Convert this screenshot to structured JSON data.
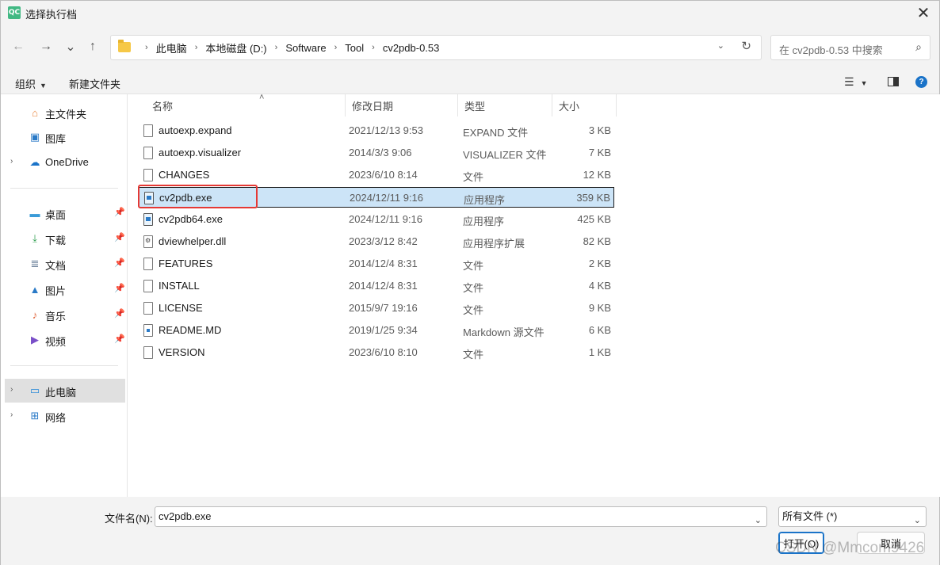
{
  "window": {
    "app_icon_text": "QC",
    "title": "选择执行档",
    "close_glyph": "✕"
  },
  "nav": {
    "back_glyph": "←",
    "forward_glyph": "→",
    "recent_glyph": "⌄",
    "up_glyph": "↑",
    "breadcrumbs": [
      "此电脑",
      "本地磁盘 (D:)",
      "Software",
      "Tool",
      "cv2pdb-0.53"
    ],
    "sep_glyph": "›",
    "dropdown_glyph": "⌄",
    "refresh_glyph": "↻",
    "search_placeholder": "在 cv2pdb-0.53 中搜索",
    "search_glyph": "⌕"
  },
  "commands": {
    "organize": "组织",
    "organize_arrow": "▼",
    "new_folder": "新建文件夹",
    "view_glyph": "☰",
    "view_arrow": "▼",
    "help_glyph": "?"
  },
  "sidebar": {
    "quick": [
      {
        "label": "主文件夹",
        "icon": "home-icon",
        "glyph": "⌂",
        "color": "#e8833a"
      },
      {
        "label": "图库",
        "icon": "gallery-icon",
        "glyph": "▣",
        "color": "#2a7ac7"
      },
      {
        "label": "OneDrive",
        "icon": "cloud-icon",
        "glyph": "☁",
        "color": "#1a73c8",
        "chev": "›"
      }
    ],
    "pinned": [
      {
        "label": "桌面",
        "icon": "desktop-icon",
        "glyph": "▬",
        "color": "#3a9bd8"
      },
      {
        "label": "下载",
        "icon": "download-icon",
        "glyph": "⤓",
        "color": "#2e9e4e"
      },
      {
        "label": "文档",
        "icon": "documents-icon",
        "glyph": "≣",
        "color": "#6a7f99"
      },
      {
        "label": "图片",
        "icon": "pictures-icon",
        "glyph": "▲",
        "color": "#2a7ac7"
      },
      {
        "label": "音乐",
        "icon": "music-icon",
        "glyph": "♪",
        "color": "#e0643a"
      },
      {
        "label": "视频",
        "icon": "video-icon",
        "glyph": "▶",
        "color": "#7a4fc8"
      }
    ],
    "pin_glyph": "📌",
    "locations": [
      {
        "label": "此电脑",
        "icon": "this-pc-icon",
        "glyph": "▭",
        "color": "#2a8ad8",
        "chev": "›"
      },
      {
        "label": "网络",
        "icon": "network-icon",
        "glyph": "⊞",
        "color": "#2a7ac7",
        "chev": "›"
      }
    ]
  },
  "columns": {
    "name": "名称",
    "date": "修改日期",
    "type": "类型",
    "size": "大小",
    "sort_glyph": "˄"
  },
  "files": [
    {
      "name": "autoexp.expand",
      "date": "2021/12/13 9:53",
      "type": "EXPAND 文件",
      "size": "3 KB",
      "kind": "file"
    },
    {
      "name": "autoexp.visualizer",
      "date": "2014/3/3 9:06",
      "type": "VISUALIZER 文件",
      "size": "7 KB",
      "kind": "file"
    },
    {
      "name": "CHANGES",
      "date": "2023/6/10 8:14",
      "type": "文件",
      "size": "12 KB",
      "kind": "file"
    },
    {
      "name": "cv2pdb.exe",
      "date": "2024/12/11 9:16",
      "type": "应用程序",
      "size": "359 KB",
      "kind": "exe"
    },
    {
      "name": "cv2pdb64.exe",
      "date": "2024/12/11 9:16",
      "type": "应用程序",
      "size": "425 KB",
      "kind": "exe"
    },
    {
      "name": "dviewhelper.dll",
      "date": "2023/3/12 8:42",
      "type": "应用程序扩展",
      "size": "82 KB",
      "kind": "dll"
    },
    {
      "name": "FEATURES",
      "date": "2014/12/4 8:31",
      "type": "文件",
      "size": "2 KB",
      "kind": "file"
    },
    {
      "name": "INSTALL",
      "date": "2014/12/4 8:31",
      "type": "文件",
      "size": "4 KB",
      "kind": "file"
    },
    {
      "name": "LICENSE",
      "date": "2015/9/7 19:16",
      "type": "文件",
      "size": "9 KB",
      "kind": "file"
    },
    {
      "name": "README.MD",
      "date": "2019/1/25 9:34",
      "type": "Markdown 源文件",
      "size": "6 KB",
      "kind": "md"
    },
    {
      "name": "VERSION",
      "date": "2023/6/10 8:10",
      "type": "文件",
      "size": "1 KB",
      "kind": "file"
    }
  ],
  "selected_index": 3,
  "footer": {
    "filename_label": "文件名(N):",
    "filename_value": "cv2pdb.exe",
    "dropdown_glyph": "⌄",
    "filter_value": "所有文件 (*)",
    "open_label": "打开(O)",
    "cancel_label": "取消"
  },
  "watermark": "CSDN @Mmcom9426"
}
